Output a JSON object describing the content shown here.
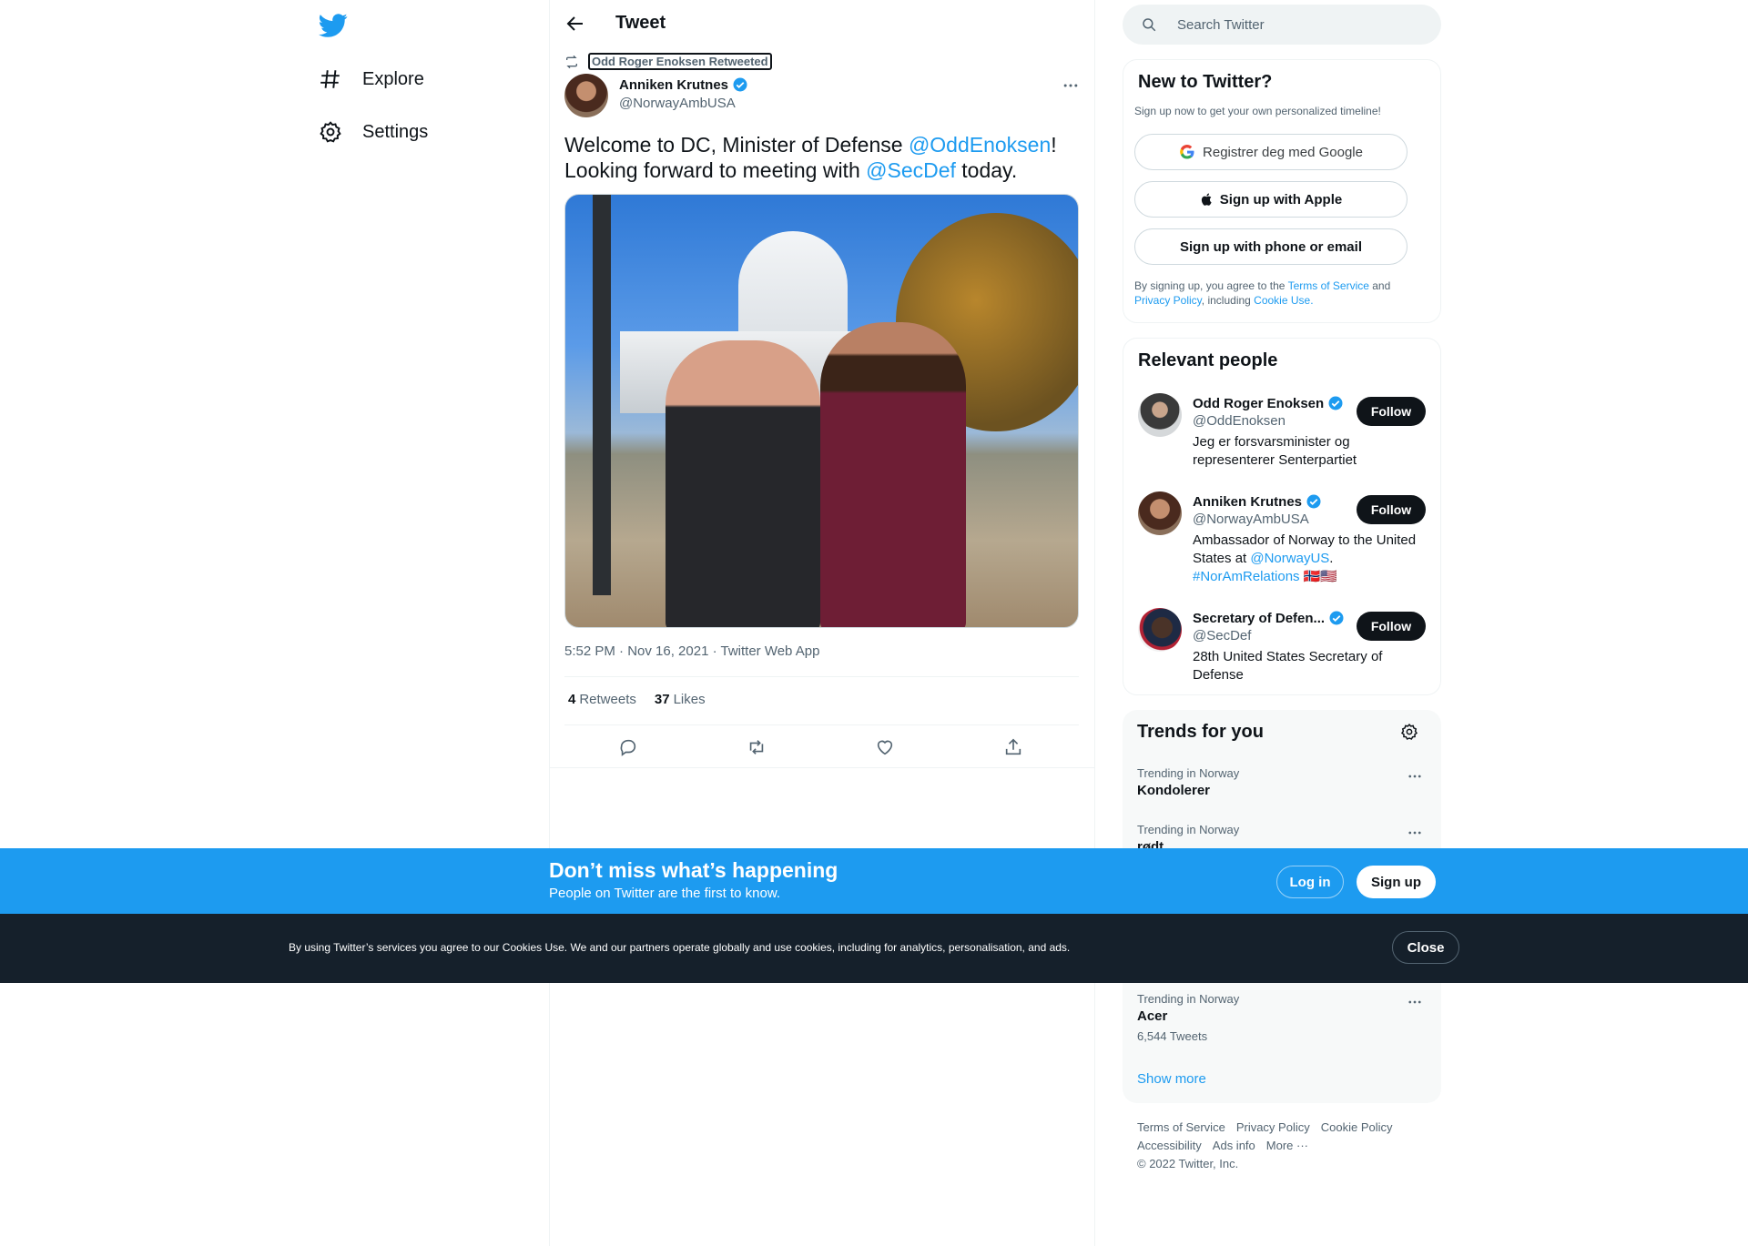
{
  "nav": {
    "items": [
      {
        "label": "Explore",
        "icon": "hashtag-icon"
      },
      {
        "label": "Settings",
        "icon": "gear-icon"
      }
    ]
  },
  "header": {
    "title": "Tweet"
  },
  "tweet": {
    "retweeted_by": "Odd Roger Enoksen Retweeted",
    "author_name": "Anniken Krutnes",
    "author_handle": "@NorwayAmbUSA",
    "text_parts": {
      "p1": "Welcome to DC, Minister of Defense ",
      "mention1": "@OddEnoksen",
      "p2": "! Looking forward to meeting with ",
      "mention2": "@SecDef",
      "p3": " today."
    },
    "meta": "5:52 PM · Nov 16, 2021 · Twitter Web App",
    "retweets_count": "4",
    "retweets_label": "Retweets",
    "likes_count": "37",
    "likes_label": "Likes"
  },
  "search": {
    "placeholder": "Search Twitter"
  },
  "new_to_twitter": {
    "title": "New to Twitter?",
    "subtitle": "Sign up now to get your own personalized timeline!",
    "google_label": "Registrer deg med Google",
    "apple_label": "Sign up with Apple",
    "phone_label": "Sign up with phone or email",
    "legal_1": "By signing up, you agree to the ",
    "terms": "Terms of Service",
    "legal_2": " and",
    "privacy": "Privacy Policy",
    "legal_3": ", including ",
    "cookie_use": "Cookie Use."
  },
  "relevant": {
    "title": "Relevant people",
    "follow_label": "Follow",
    "people": [
      {
        "name": "Odd Roger Enoksen",
        "handle": "@OddEnoksen",
        "bio": "Jeg er forsvarsminister og representerer Senterpartiet"
      },
      {
        "name": "Anniken Krutnes",
        "handle": "@NorwayAmbUSA",
        "bio_1": "Ambassador of Norway to the United States at ",
        "bio_link": "@NorwayUS",
        "bio_2": ".",
        "bio_tag": "#NorAmRelations",
        "bio_flags": "🇳🇴🇺🇸"
      },
      {
        "name": "Secretary of Defen...",
        "handle": "@SecDef",
        "bio": "28th United States Secretary of Defense"
      }
    ]
  },
  "trends": {
    "title": "Trends for you",
    "items": [
      {
        "category": "Trending in Norway",
        "name": "Kondolerer"
      },
      {
        "category": "Trending in Norway",
        "name": "rødt"
      },
      {
        "category": "Trending in Norway",
        "name": "Acer",
        "count": "6,544 Tweets"
      }
    ],
    "show_more": "Show more"
  },
  "footer": {
    "links": [
      "Terms of Service",
      "Privacy Policy",
      "Cookie Policy",
      "Accessibility",
      "Ads info",
      "More ···"
    ],
    "copyright": "© 2022 Twitter, Inc."
  },
  "banner": {
    "title": "Don’t miss what’s happening",
    "subtitle": "People on Twitter are the first to know.",
    "login": "Log in",
    "signup": "Sign up"
  },
  "cookie": {
    "text": "By using Twitter’s services you agree to our Cookies Use. We and our partners operate globally and use cookies, including for analytics, personalisation, and ads.",
    "close": "Close"
  },
  "colors": {
    "accent": "#1d9bf0",
    "text": "#0f1419",
    "muted": "#536471",
    "cookie_bg": "#15202b"
  }
}
